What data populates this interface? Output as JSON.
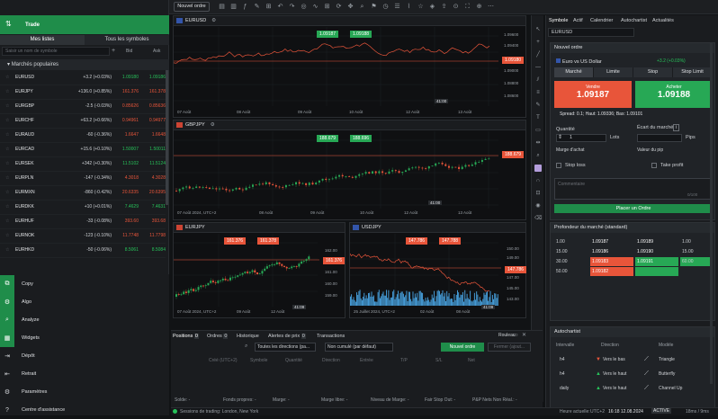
{
  "topbar": {
    "new_order_label": "Nouvel ordre"
  },
  "left": {
    "trade_label": "Trade",
    "tabs": [
      "Mes listes",
      "Tous les symboles"
    ],
    "search_placeholder": "Saisir un nom de symbole",
    "col_bid": "Bid",
    "col_ask": "Ask",
    "group": "Marchés populaires",
    "rows": [
      {
        "sym": "EURUSD",
        "chg": "+3.2 (+0.03%)",
        "bid": "1.09180",
        "ask": "1.09186",
        "dir": "g"
      },
      {
        "sym": "EURJPY",
        "chg": "+136.0 (+0.85%)",
        "bid": "161.376",
        "ask": "161.378",
        "dir": "r"
      },
      {
        "sym": "EURGBP",
        "chg": "-2.5 (-0.03%)",
        "bid": "0.85626",
        "ask": "0.85636",
        "dir": "r"
      },
      {
        "sym": "EURCHF",
        "chg": "+63.2 (+0.66%)",
        "bid": "0.94961",
        "ask": "0.94977",
        "dir": "r"
      },
      {
        "sym": "EURAUD",
        "chg": "-60 (-0.36%)",
        "bid": "1.6647",
        "ask": "1.6648",
        "dir": "r"
      },
      {
        "sym": "EURCAD",
        "chg": "+15.6 (+0.10%)",
        "bid": "1.50007",
        "ask": "1.50011",
        "dir": "g"
      },
      {
        "sym": "EURSEK",
        "chg": "+342 (+0.30%)",
        "bid": "11.5102",
        "ask": "11.5124",
        "dir": "g"
      },
      {
        "sym": "EURPLN",
        "chg": "-147 (-0.34%)",
        "bid": "4.3018",
        "ask": "4.3028",
        "dir": "r"
      },
      {
        "sym": "EURMXN",
        "chg": "-860 (-0.42%)",
        "bid": "20.6335",
        "ask": "20.6395",
        "dir": "r"
      },
      {
        "sym": "EURDKK",
        "chg": "+10 (+0.01%)",
        "bid": "7.4629",
        "ask": "7.4631",
        "dir": "g"
      },
      {
        "sym": "EURHUF",
        "chg": "-33 (-0.08%)",
        "bid": "393.60",
        "ask": "393.68",
        "dir": "r"
      },
      {
        "sym": "EURNOK",
        "chg": "-123 (-0.10%)",
        "bid": "11.7748",
        "ask": "11.7798",
        "dir": "r"
      },
      {
        "sym": "EURHKD",
        "chg": "-50 (-0.06%)",
        "bid": "8.5061",
        "ask": "8.5084",
        "dir": "g"
      }
    ],
    "menu": [
      {
        "label": "Copy",
        "icon": "copy-icon",
        "glyph": "⧉",
        "active": true
      },
      {
        "label": "Algo",
        "icon": "algo-icon",
        "glyph": "⚙",
        "active": true
      },
      {
        "label": "Analyze",
        "icon": "analyze-icon",
        "glyph": "⌕",
        "active": true
      },
      {
        "label": "Widgets",
        "icon": "widgets-icon",
        "glyph": "▦",
        "active": true
      },
      {
        "label": "Dépôt",
        "icon": "deposit-icon",
        "glyph": "⇥",
        "active": false
      },
      {
        "label": "Retrait",
        "icon": "withdraw-icon",
        "glyph": "⇤",
        "active": false
      },
      {
        "label": "Paramètres",
        "icon": "settings-icon",
        "glyph": "⚙",
        "active": false
      },
      {
        "label": "Centre d'assistance",
        "icon": "help-icon",
        "glyph": "?",
        "active": false
      }
    ]
  },
  "charts": {
    "eurusd": {
      "symbol": "EURUSD",
      "sell": "1.09187",
      "buy": "1.09188",
      "last": "1.09180",
      "y_ticks": [
        "1.09600",
        "1.09400",
        "1.09200",
        "1.09000",
        "1.08800",
        "1.08600"
      ],
      "x_ticks": [
        "07 Août",
        "08 Août",
        "09 Août",
        "10 Août",
        "12 Août",
        "13 Août"
      ],
      "timer": "41:00",
      "tz": "UTC+2"
    },
    "gbpjpy": {
      "symbol": "GBPJPY",
      "sell": "188.679",
      "buy": "188.696",
      "last": "188.679",
      "x_ticks": [
        "07 Août 2024, UTC+2",
        "08 Août",
        "09 Août",
        "10 Août",
        "12 Août",
        "13 Août"
      ],
      "timer": "41:00"
    },
    "eurjpy": {
      "symbol": "EURJPY",
      "sell": "161.376",
      "buy": "161.378",
      "last": "161.376",
      "y_ticks": [
        "162.00",
        "161.00",
        "160.00",
        "159.00"
      ],
      "x_ticks": [
        "07 Août 2024, UTC+2",
        "09 Août",
        "12 Août"
      ],
      "timer": "41:09"
    },
    "usdjpy": {
      "symbol": "USDJPY",
      "sell": "147.786",
      "buy": "147.788",
      "last": "147.786",
      "y_ticks": [
        "150.00",
        "149.00",
        "147.00",
        "145.00",
        "143.00"
      ],
      "x_ticks": [
        "25 Juillet 2024, UTC+2",
        "02 Août",
        "08 Août"
      ],
      "timer": "41:09"
    }
  },
  "bottom": {
    "tabs": [
      "Positions",
      "Ordres",
      "Historique",
      "Alertes de prix",
      "Transactions"
    ],
    "count_positions": "0",
    "count_orders": "0",
    "count_history": "0",
    "filter_dirs": "Toutes les directions (pa...",
    "filter_cumul": "Non cumulé (par défaut)",
    "new_order": "Nouvel ordre",
    "close_all": "Fermer (ajout...",
    "rouleau": "Rouleau",
    "cols": [
      "Créé (UTC+2)",
      "Symbole",
      "Quantité",
      "Direction",
      "Entrée",
      "T/P",
      "S/L",
      "Net"
    ],
    "summary": [
      "Solde: -",
      "Fonds propres: -",
      "Marge: -",
      "Marge libre: -",
      "Niveau de Marge: -",
      "Fair Stop Out: -",
      "P&P Nets Non Réal.: -"
    ]
  },
  "right": {
    "tabs": [
      "Symbole",
      "Actif",
      "Calendrier",
      "Autochartist",
      "Actualités"
    ],
    "symbol": "EURUSD",
    "new_order_title": "Nouvel ordre",
    "pair_name": "Euro vs US Dollar",
    "pair_change": "+3.2 (+0.03%)",
    "order_types": [
      "Marché",
      "Limite",
      "Stop",
      "Stop Limit"
    ],
    "sell_label": "Vendre",
    "sell_price": "1.09187",
    "buy_label": "Acheter",
    "buy_price": "1.09188",
    "spread": "Spread: 0.1; Haut: 1.09336; Bas: 1.09101",
    "qty_label": "Quantité",
    "qty_value": "1",
    "qty_unit": "Lots",
    "gap_label": "Écart du marché",
    "gap_unit": "Pips",
    "margin_label": "Marge d'achat",
    "pip_label": "Valeur du pip",
    "stop_loss": "Stop loss",
    "take_profit": "Take profit",
    "comment_placeholder": "Commentaire",
    "comment_count": "0/100",
    "place_order": "Placer un Ordre",
    "depth_title": "Profondeur du marché (standard)",
    "depth": [
      {
        "lq": "1.00",
        "bid": "1.09187",
        "ask": "1.09189",
        "rq": "1.00"
      },
      {
        "lq": "15.00",
        "bid": "1.09186",
        "ask": "1.09190",
        "rq": "15.00"
      },
      {
        "lq": "30.00",
        "bid": "1.09183",
        "ask": "1.09191",
        "rq": "60.00"
      },
      {
        "lq": "50.00",
        "bid": "1.09182",
        "ask": "",
        "rq": ""
      }
    ],
    "auto_title": "Autochartist",
    "auto_cols": [
      "Intervalle",
      "Direction",
      "Modèle"
    ],
    "auto_rows": [
      {
        "i": "h4",
        "d": "Vers le bas",
        "m": "Triangle",
        "dir": "down"
      },
      {
        "i": "h4",
        "d": "Vers le haut",
        "m": "Butterfly",
        "dir": "up"
      },
      {
        "i": "daily",
        "d": "Vers le haut",
        "m": "Channel Up",
        "dir": "up"
      }
    ]
  },
  "status": {
    "session": "Sessions de trading: London, New York",
    "time_label": "Heure actuelle:",
    "tz": "UTC+2",
    "time": "16:18 12.08.2024",
    "active": "ACTIVE",
    "latency": "18ms / 9ms"
  },
  "colors": {
    "green": "#27a855",
    "red": "#e8553a"
  }
}
